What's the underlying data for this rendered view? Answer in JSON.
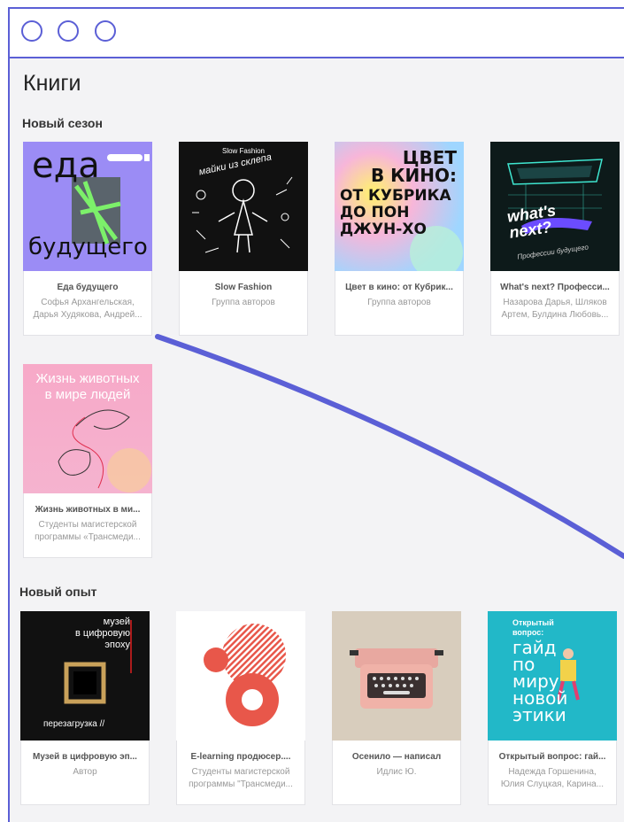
{
  "page": {
    "title": "Книги"
  },
  "sections": [
    {
      "title": "Новый сезон",
      "books": [
        {
          "title": "Еда будущего",
          "author": "Софья Архангельская, Дарья Худякова, Андрей...",
          "cover_text": [
            "еда",
            "будущего"
          ],
          "cover_color": "#9b8cf5"
        },
        {
          "title": "Slow Fashion",
          "author": "Группа авторов",
          "cover_text": [
            "Slow Fashion",
            "майки из склепа"
          ],
          "cover_color": "#111111"
        },
        {
          "title": "Цвет в кино: от Кубрик...",
          "author": "Группа авторов",
          "cover_text": [
            "ЦВЕТ",
            "В КИНО:",
            "ОТ КУБРИКА",
            "ДО ПОН",
            "ДЖУН-ХО"
          ],
          "cover_color": "#f5d1e8"
        },
        {
          "title": "What's next? Професси...",
          "author": "Назарова Дарья, Шляков Артем, Булдина Любовь...",
          "cover_text": [
            "what's",
            "next?",
            "Профессии будущего"
          ],
          "cover_color": "#0d1a1a"
        }
      ]
    },
    {
      "title": "",
      "books": [
        {
          "title": "Жизнь животных в ми...",
          "author": "Студенты магистерской программы «Трансмеди...",
          "cover_text": [
            "Жизнь животных",
            "в мире людей"
          ],
          "cover_color": "#f7a9c8"
        }
      ]
    },
    {
      "title": "Новый опыт",
      "books": [
        {
          "title": "Музей в цифровую эп...",
          "author": "Автор",
          "cover_text": [
            "музей",
            "в цифровую",
            "эпоху",
            "перезагрузка //"
          ],
          "cover_color": "#111111"
        },
        {
          "title": "E-learning продюсер....",
          "author": "Студенты магистерской программы \"Трансмеди...",
          "cover_text": [],
          "cover_color": "#ffffff"
        },
        {
          "title": "Осенило — написал",
          "author": "Идлис Ю.",
          "cover_text": [],
          "cover_color": "#d8cdbd"
        },
        {
          "title": "Открытый вопрос: гай...",
          "author": "Надежда Горшенина, Юлия Слуцкая, Карина...",
          "cover_text": [
            "Открытый",
            "вопрос:",
            "гайд",
            "по",
            "миру",
            "новой",
            "этики"
          ],
          "cover_color": "#22b8c8"
        }
      ]
    }
  ],
  "colors": {
    "accent": "#5b5fd6",
    "background": "#f3f3f5"
  }
}
